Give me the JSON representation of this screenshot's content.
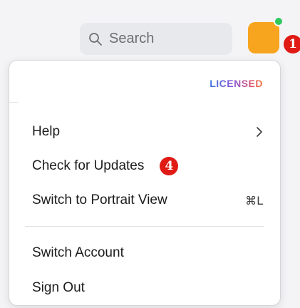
{
  "header": {
    "search": {
      "placeholder": "Search",
      "icon": "search-icon"
    },
    "avatar": {
      "color": "#f7a51e",
      "status_color": "#2fc85c"
    },
    "annotation_badge": "1"
  },
  "menu": {
    "license_label": "LICENSED",
    "items": [
      {
        "label": "Help",
        "trailing": "chevron-right-icon"
      },
      {
        "label": "Check for Updates",
        "annotation_badge": "4"
      },
      {
        "label": "Switch to Portrait View",
        "shortcut": "⌘L"
      },
      {
        "label": "Switch Account"
      },
      {
        "label": "Sign Out"
      }
    ]
  },
  "colors": {
    "background": "#f4f4f6",
    "menu_background": "#ffffff",
    "badge_red": "#e01a14"
  }
}
